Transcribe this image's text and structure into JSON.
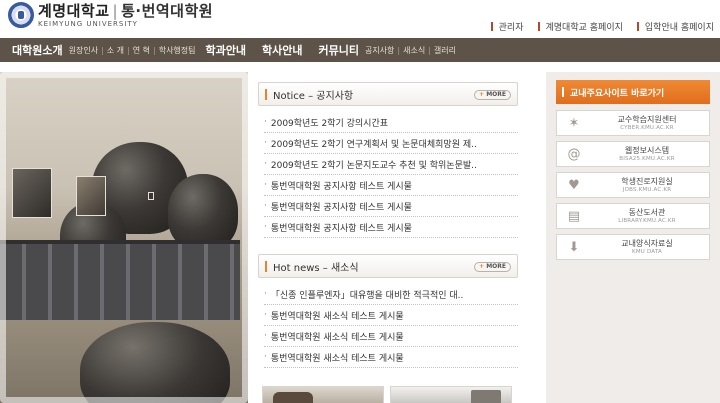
{
  "header": {
    "logo_main": "계명대학교",
    "logo_divider": "|",
    "logo_sub": "통·번역대학원",
    "logo_en": "KEIMYUNG UNIVERSITY",
    "top_links": [
      {
        "label": "관리자"
      },
      {
        "label": "계명대학교 홈페이지"
      },
      {
        "label": "입학안내 홈페이지"
      }
    ]
  },
  "gnb": [
    {
      "label": "대학원소개",
      "subs": [
        "원장인사",
        "소 개",
        "연 혁",
        "학사행정팀"
      ]
    },
    {
      "label": "학과안내",
      "subs": []
    },
    {
      "label": "학사안내",
      "subs": []
    },
    {
      "label": "커뮤니티",
      "subs": [
        "공지사항",
        "새소식",
        "갤러리"
      ]
    }
  ],
  "notice": {
    "title": "Notice – 공지사항",
    "more": "MORE",
    "items": [
      "2009학년도 2학기 강의시간표",
      "2009학년도 2학기 연구계획서 및 논문대체희망원 제..",
      "2009학년도 2학기 논문지도교수 추천 및 학위논문발..",
      "통번역대학원 공지사항 테스트 게시물",
      "통번역대학원 공지사항 테스트 게시물",
      "통번역대학원 공지사항 테스트 게시물"
    ]
  },
  "news": {
    "title": "Hot news – 새소식",
    "more": "MORE",
    "items": [
      "「신종 인플루엔자」대유행을 대비한 적극적인 대..",
      "통번역대학원 새소식 테스트 게시물",
      "통번역대학원 새소식 테스트 게시물",
      "통번역대학원 새소식 테스트 게시물"
    ]
  },
  "shortcuts": {
    "title": "교내주요사이트 바로가기",
    "items": [
      {
        "name": "교수학습지원센터",
        "url": "CYBER.KMU.AC.KR",
        "icon": "sparkle-icon"
      },
      {
        "name": "웹정보시스템",
        "url": "BISA25.KMU.AC.KR",
        "icon": "at-sign-icon"
      },
      {
        "name": "학생진로지원실",
        "url": "JOBS.KMU.AC.KR",
        "icon": "heart-icon"
      },
      {
        "name": "동산도서관",
        "url": "LIBRARY.KMU.AC.KR",
        "icon": "book-icon"
      },
      {
        "name": "교내양식자료실",
        "url": "KMU DATA",
        "icon": "download-icon"
      }
    ]
  },
  "colors": {
    "gnb_bg": "#5e5348",
    "accent_orange": "#e06d1c",
    "top_link_bar": "#b5472a"
  }
}
